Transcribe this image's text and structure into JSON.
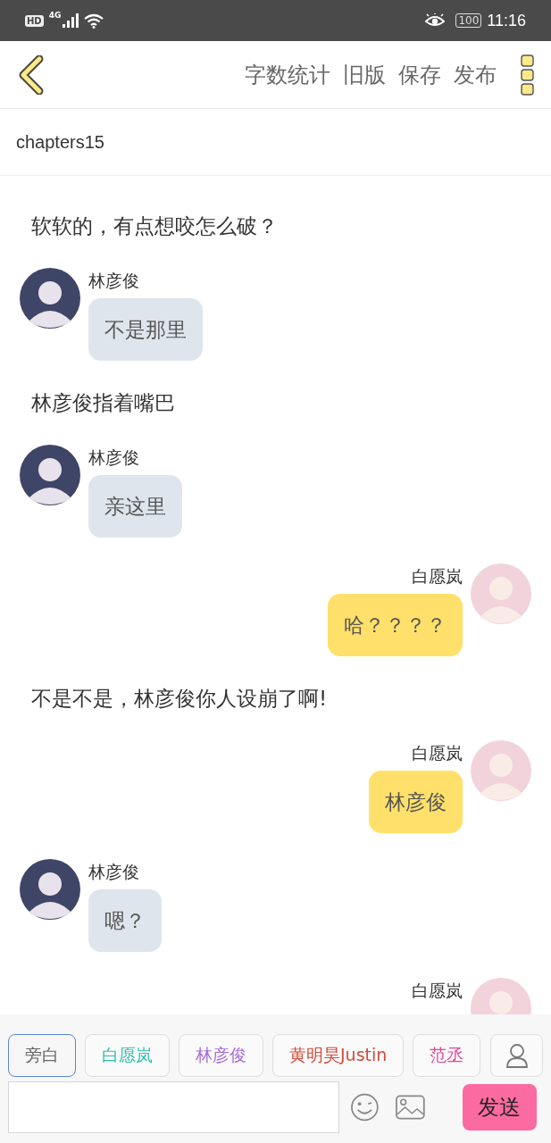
{
  "status_bar": {
    "hd": "HD",
    "network": "4G",
    "battery": "100",
    "time": "11:16"
  },
  "toolbar": {
    "actions": [
      "字数统计",
      "旧版",
      "保存",
      "发布"
    ]
  },
  "chapter_title": "chapters15",
  "messages": [
    {
      "kind": "narration",
      "text": "软软的，有点想咬怎么破？"
    },
    {
      "kind": "left",
      "name": "林彦俊",
      "text": "不是那里"
    },
    {
      "kind": "narration",
      "text": "林彦俊指着嘴巴"
    },
    {
      "kind": "left",
      "name": "林彦俊",
      "text": "亲这里"
    },
    {
      "kind": "right",
      "name": "白愿岚",
      "text": "哈？？？？"
    },
    {
      "kind": "narration",
      "text": "不是不是，林彦俊你人设崩了啊!"
    },
    {
      "kind": "right",
      "name": "白愿岚",
      "text": "林彦俊"
    },
    {
      "kind": "left",
      "name": "林彦俊",
      "text": "嗯？"
    },
    {
      "kind": "right",
      "name": "白愿岚"
    }
  ],
  "roles": [
    {
      "label": "旁白",
      "selected": true,
      "color": "#666666"
    },
    {
      "label": "白愿岚",
      "selected": false,
      "color": "#2ebfb0"
    },
    {
      "label": "林彦俊",
      "selected": false,
      "color": "#a56bd6"
    },
    {
      "label": "黄明昊Justin",
      "selected": false,
      "color": "#d24b3a"
    },
    {
      "label": "范丞",
      "selected": false,
      "color": "#e0489a"
    }
  ],
  "send_button": "发送"
}
